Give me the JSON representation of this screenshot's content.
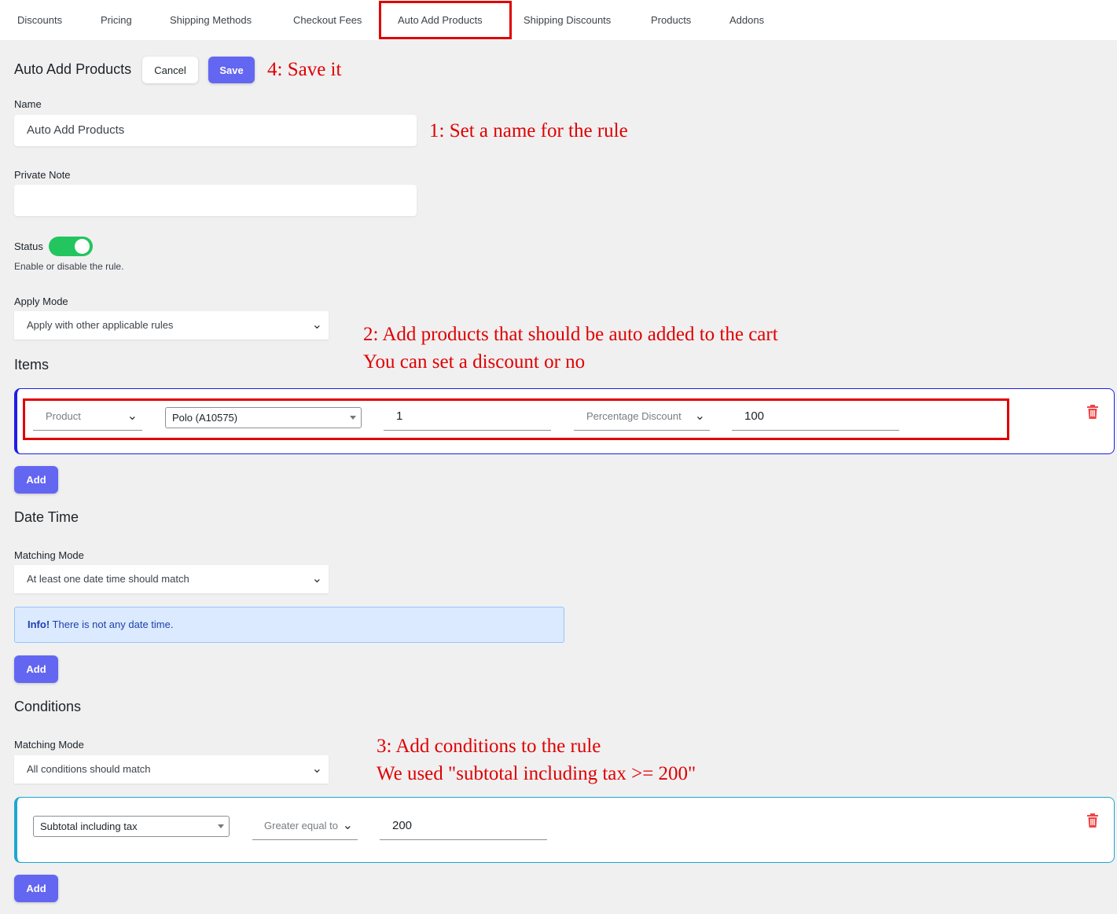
{
  "tabs": [
    "Discounts",
    "Pricing",
    "Shipping Methods",
    "Checkout Fees",
    "Auto Add Products",
    "Shipping Discounts",
    "Products",
    "Addons"
  ],
  "header": {
    "title": "Auto Add Products",
    "cancel_label": "Cancel",
    "save_label": "Save"
  },
  "form": {
    "name_label": "Name",
    "name_value": "Auto Add Products",
    "note_label": "Private Note",
    "note_value": "",
    "status_label": "Status",
    "status_hint": "Enable or disable the rule.",
    "status_on": true,
    "apply_mode_label": "Apply Mode",
    "apply_mode_value": "Apply with other applicable rules"
  },
  "items": {
    "title": "Items",
    "row": {
      "type": "Product",
      "product": "Polo (A10575)",
      "quantity": "1",
      "discount_type": "Percentage Discount",
      "discount_value": "100"
    },
    "add_label": "Add"
  },
  "date_time": {
    "title": "Date Time",
    "matching_label": "Matching Mode",
    "matching_value": "At least one date time should match",
    "info_strong": "Info!",
    "info_text": "There is not any date time.",
    "add_label": "Add"
  },
  "conditions": {
    "title": "Conditions",
    "matching_label": "Matching Mode",
    "matching_value": "All conditions should match",
    "row": {
      "field": "Subtotal including tax",
      "operator": "Greater equal to",
      "value": "200"
    },
    "add_label": "Add"
  },
  "annotations": {
    "save": "4: Save it",
    "name": "1: Set a name for the rule",
    "items_1": "2: Add products that should be auto added to the cart",
    "items_2": "You can set a discount or no",
    "cond_1": "3: Add conditions to the rule",
    "cond_2": "We used \"subtotal including tax >= 200\""
  },
  "colors": {
    "accent": "#6366f1",
    "toggle_on": "#22c55e",
    "annotation": "#e00000",
    "delete": "#ef4444"
  }
}
